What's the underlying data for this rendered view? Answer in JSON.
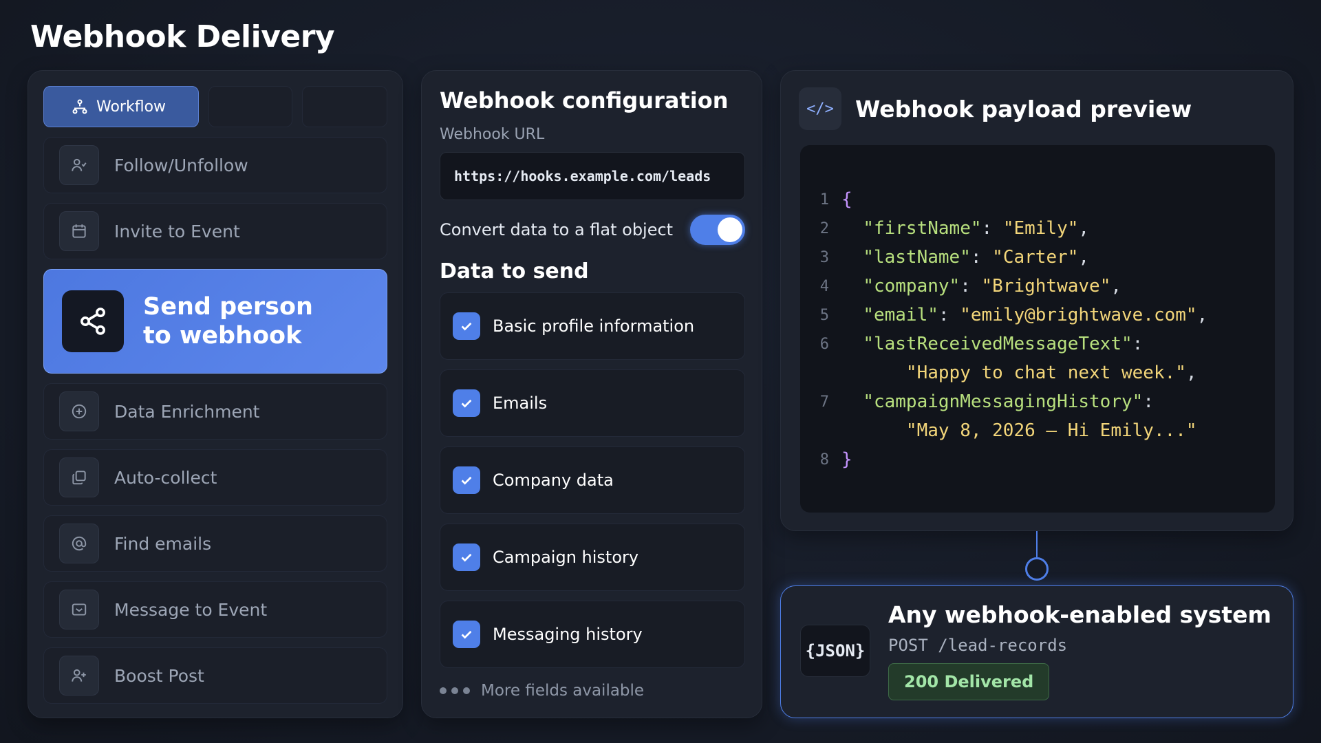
{
  "page": {
    "title": "Webhook Delivery"
  },
  "sidebar": {
    "tab_active": "Workflow",
    "items": [
      {
        "label": "Follow/Unfollow",
        "icon": "user-check-icon"
      },
      {
        "label": "Invite to Event",
        "icon": "calendar-icon"
      },
      {
        "label": "Send person to webhook",
        "icon": "share-nodes-icon",
        "selected": true
      },
      {
        "label": "Data Enrichment",
        "icon": "plus-circle-icon"
      },
      {
        "label": "Auto-collect",
        "icon": "copy-icon"
      },
      {
        "label": "Find emails",
        "icon": "at-sign-icon"
      },
      {
        "label": "Message to Event",
        "icon": "message-box-icon"
      },
      {
        "label": "Boost Post",
        "icon": "user-plus-icon"
      }
    ]
  },
  "config": {
    "title": "Webhook configuration",
    "url_label": "Webhook URL",
    "url_value": "https://hooks.example.com/leads",
    "toggle_label": "Convert data to a flat object",
    "toggle_on": true,
    "data_title": "Data to send",
    "options": [
      {
        "label": "Basic profile information",
        "checked": true
      },
      {
        "label": "Emails",
        "checked": true
      },
      {
        "label": "Company data",
        "checked": true
      },
      {
        "label": "Campaign history",
        "checked": true
      },
      {
        "label": "Messaging history",
        "checked": true
      }
    ],
    "more_label": "More fields available"
  },
  "preview": {
    "title": "Webhook payload preview",
    "icon_text": "</>",
    "lines": {
      "n1": "1",
      "n2": "2",
      "n3": "3",
      "n4": "4",
      "n5": "5",
      "n6": "6",
      "n7": "7",
      "n8": "8",
      "open": "{",
      "k1": "\"firstName\"",
      "v1": "\"Emily\"",
      "k2": "\"lastName\"",
      "v2": "\"Carter\"",
      "k3": "\"company\"",
      "v3": "\"Brightwave\"",
      "k4": "\"email\"",
      "v4": "\"emily@brightwave.com\"",
      "k5": "\"lastReceivedMessageText\"",
      "v5": "\"Happy to chat next week.\"",
      "k6": "\"campaignMessagingHistory\"",
      "v6": "\"May 8, 2026 — Hi Emily...\"",
      "close": "}"
    }
  },
  "destination": {
    "icon_text": "{JSON}",
    "title": "Any webhook-enabled system",
    "endpoint": "POST /lead-records",
    "status": "200 Delivered"
  },
  "colors": {
    "accent": "#4f7fe8",
    "success": "#a3e6a8",
    "background": "#151a25"
  }
}
